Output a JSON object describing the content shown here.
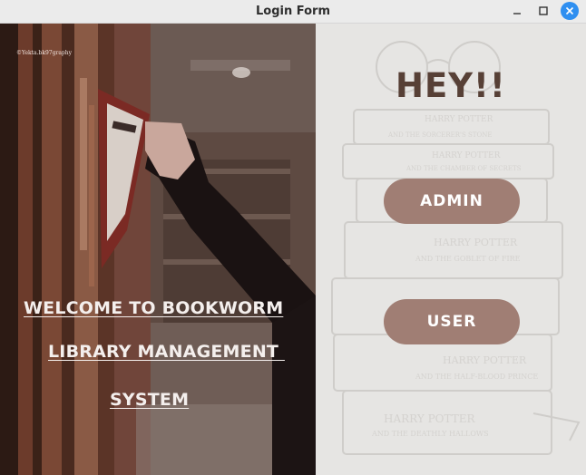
{
  "window": {
    "title": "Login Form",
    "controls": [
      "minimize-icon",
      "maximize-icon",
      "close-icon"
    ],
    "close_color": "#2f8ff0"
  },
  "left_panel": {
    "photo_credit": "©Yekta.bk97graphy",
    "welcome_lines": [
      "WELCOME TO BOOKWORM",
      "LIBRARY MANAGEMENT ",
      "SYSTEM"
    ]
  },
  "right_panel": {
    "greeting": "HEY!!",
    "admin_label": "ADMIN",
    "user_label": "USER",
    "button_color": "#a07e74",
    "greeting_color": "#574036"
  }
}
